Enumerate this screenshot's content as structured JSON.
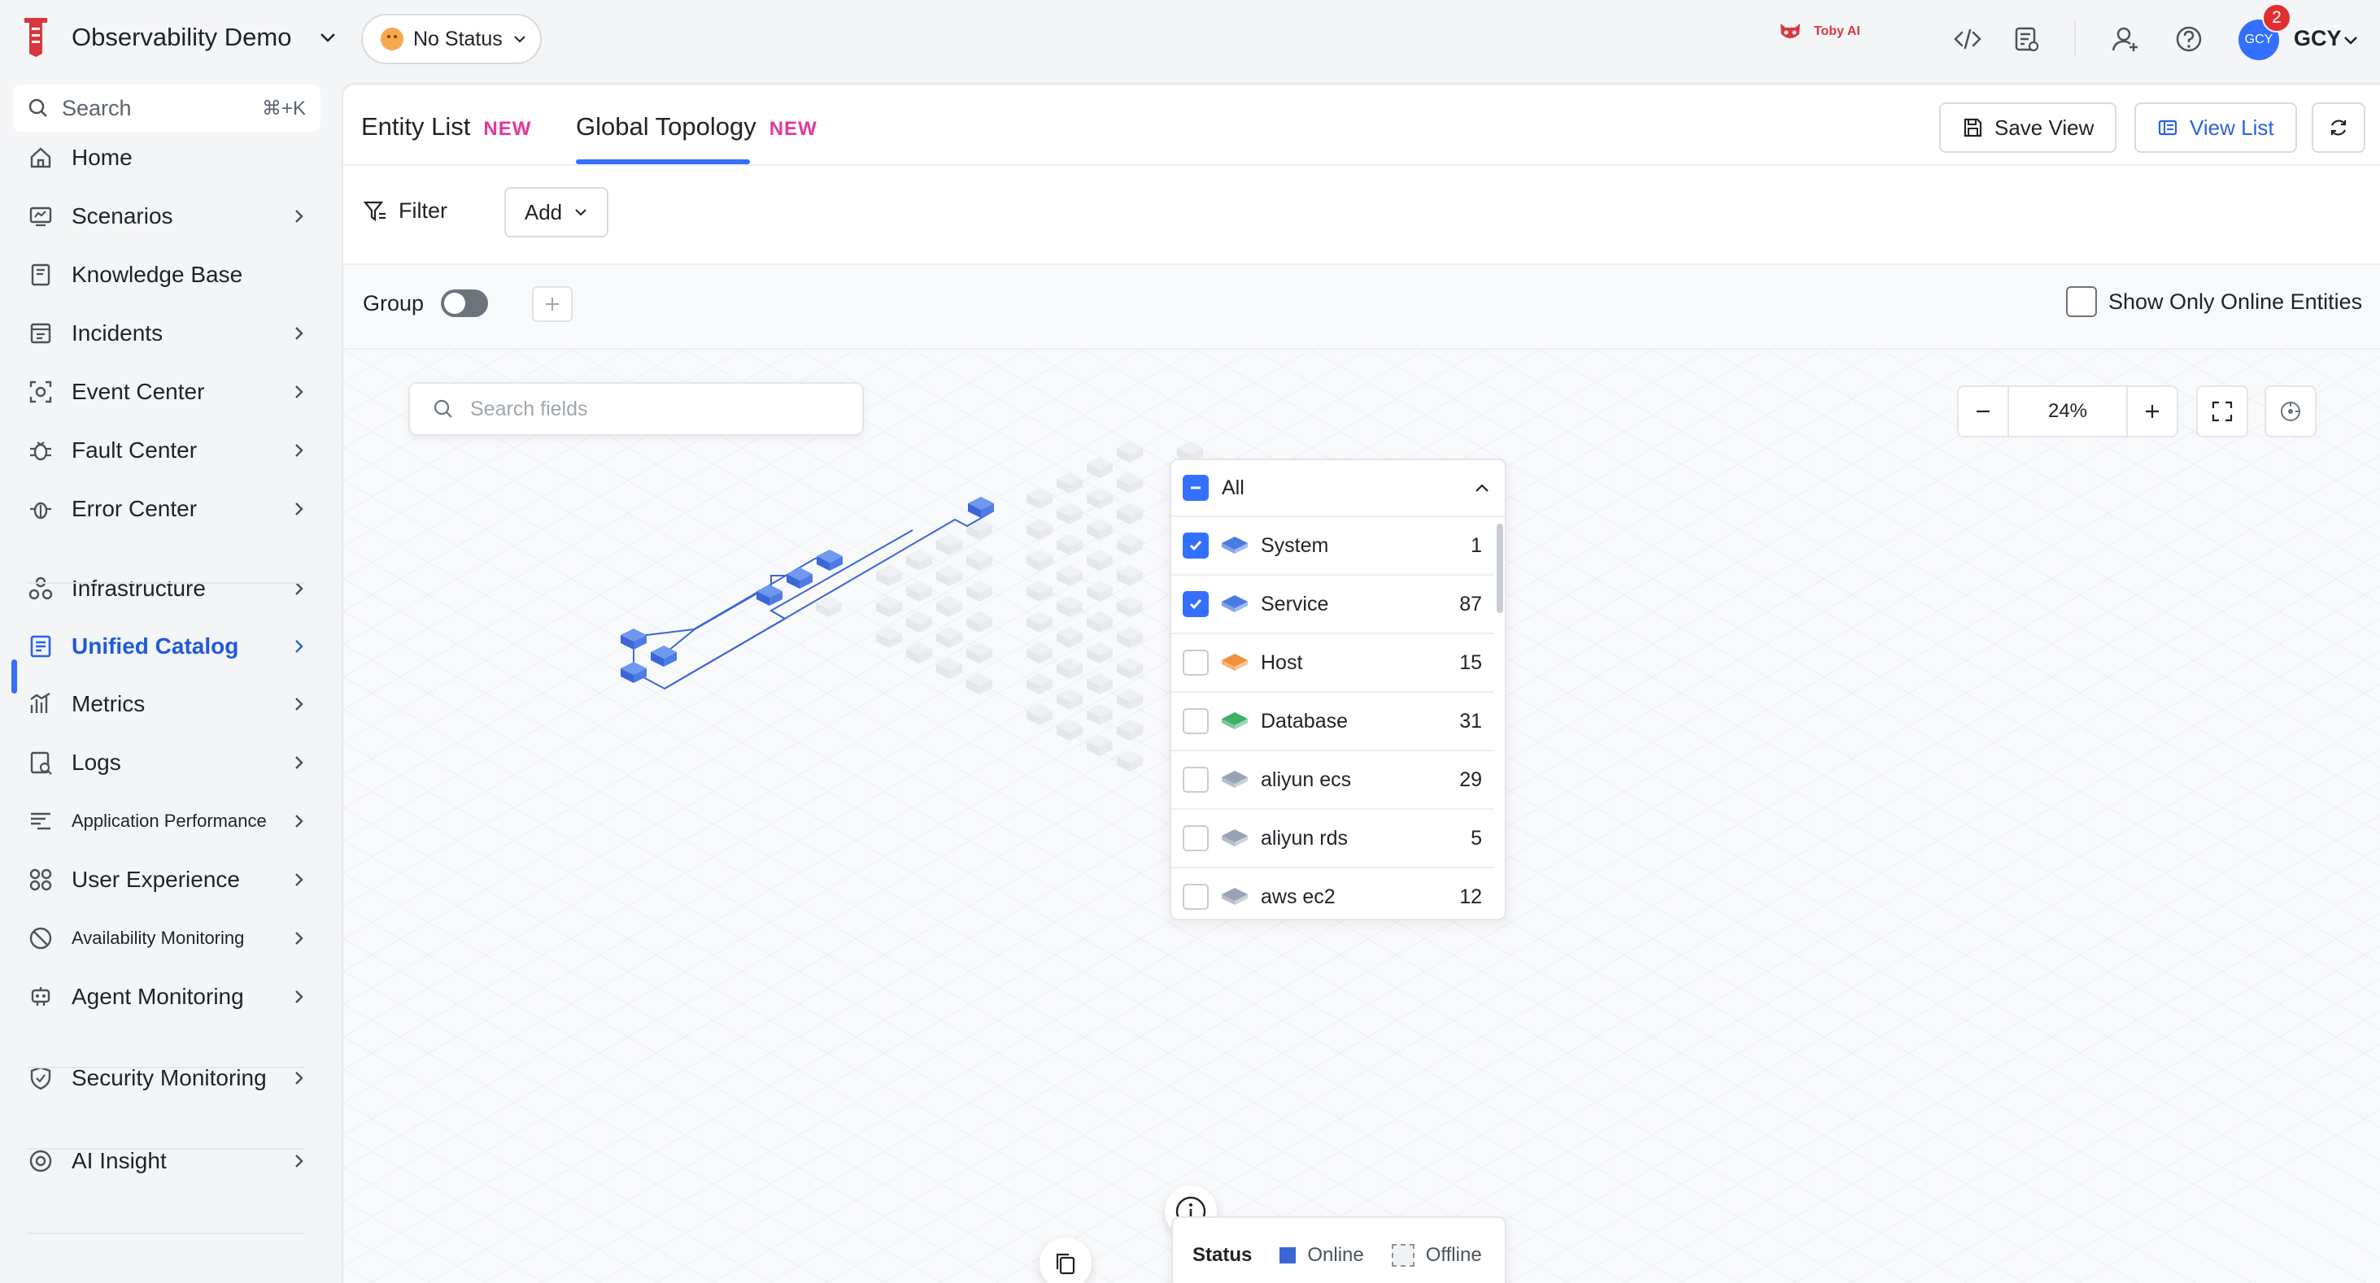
{
  "app": {
    "title": "Observability Demo",
    "status": "No Status",
    "assistant": "Toby AI",
    "user_initials": "GCY",
    "user_name": "GCY",
    "notification_count": "2",
    "accent_color": "#3370ff"
  },
  "sidebar": {
    "search_placeholder": "Search",
    "search_shortcut": "⌘+K",
    "items": [
      {
        "label": "Home",
        "icon": "home-icon",
        "chevron": false
      },
      {
        "label": "Scenarios",
        "icon": "scenarios-icon",
        "chevron": true
      },
      {
        "label": "Knowledge Base",
        "icon": "book-icon",
        "chevron": false
      },
      {
        "label": "Incidents",
        "icon": "incidents-icon",
        "chevron": true
      },
      {
        "label": "Event Center",
        "icon": "event-icon",
        "chevron": true
      },
      {
        "label": "Fault Center",
        "icon": "fault-icon",
        "chevron": true
      },
      {
        "label": "Error Center",
        "icon": "bug-icon",
        "chevron": true
      },
      {
        "label": "Infrastructure",
        "icon": "infrastructure-icon",
        "chevron": true
      },
      {
        "label": "Unified Catalog",
        "icon": "catalog-icon",
        "chevron": true,
        "active": true
      },
      {
        "label": "Metrics",
        "icon": "metrics-icon",
        "chevron": true
      },
      {
        "label": "Logs",
        "icon": "logs-icon",
        "chevron": true
      },
      {
        "label": "Application Performance",
        "icon": "apm-icon",
        "chevron": true
      },
      {
        "label": "User Experience",
        "icon": "user-experience-icon",
        "chevron": true
      },
      {
        "label": "Availability Monitoring",
        "icon": "availability-icon",
        "chevron": true
      },
      {
        "label": "Agent Monitoring",
        "icon": "agent-icon",
        "chevron": true
      },
      {
        "label": "Security Monitoring",
        "icon": "shield-icon",
        "chevron": true
      },
      {
        "label": "AI Insight",
        "icon": "ai-insight-icon",
        "chevron": true
      }
    ]
  },
  "tabs": [
    {
      "label": "Entity List",
      "badge": "NEW"
    },
    {
      "label": "Global Topology",
      "badge": "NEW",
      "active": true
    }
  ],
  "toolbar": {
    "save_view": "Save View",
    "view_list": "View List",
    "filter": "Filter",
    "add": "Add",
    "group": "Group",
    "show_online": "Show Only Online Entities"
  },
  "canvas": {
    "search_placeholder": "Search fields",
    "zoom": "24%"
  },
  "entity_filter": {
    "all_label": "All",
    "items": [
      {
        "label": "System",
        "count": "1",
        "checked": true,
        "color": "#4a7be0"
      },
      {
        "label": "Service",
        "count": "87",
        "checked": true,
        "color": "#4a7be0"
      },
      {
        "label": "Host",
        "count": "15",
        "checked": false,
        "color": "#f0913a"
      },
      {
        "label": "Database",
        "count": "31",
        "checked": false,
        "color": "#3fb068"
      },
      {
        "label": "aliyun ecs",
        "count": "29",
        "checked": false,
        "color": "#9aa3b5"
      },
      {
        "label": "aliyun rds",
        "count": "5",
        "checked": false,
        "color": "#9aa3b5"
      },
      {
        "label": "aws ec2",
        "count": "12",
        "checked": false,
        "color": "#9aa3b5"
      }
    ]
  },
  "status_legend": {
    "title": "Status",
    "online": "Online",
    "offline": "Offline",
    "online_color": "#3a66d6"
  }
}
